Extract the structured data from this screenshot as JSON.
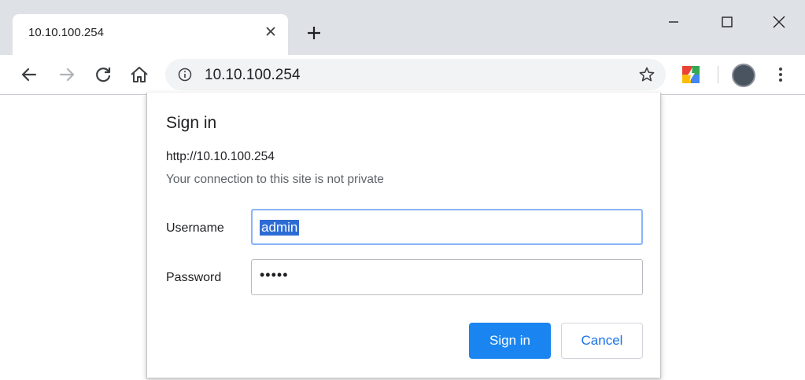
{
  "browser": {
    "tab": {
      "title": "10.10.100.254",
      "close_icon": "close-icon"
    },
    "new_tab_icon": "plus-icon",
    "window_controls": [
      "minimize-icon",
      "maximize-icon",
      "close-icon"
    ],
    "toolbar": {
      "back_icon": "arrow-left-icon",
      "forward_icon": "arrow-right-icon",
      "reload_icon": "reload-icon",
      "home_icon": "home-icon",
      "address": "10.10.100.254",
      "info_icon": "info-icon",
      "bookmark_icon": "star-icon",
      "extension_icon": "extension-icon",
      "profile_icon": "avatar",
      "menu_icon": "kebab-menu-icon"
    }
  },
  "dialog": {
    "title": "Sign in",
    "origin": "http://10.10.100.254",
    "warning": "Your connection to this site is not private",
    "username_label": "Username",
    "username_value": "admin",
    "password_label": "Password",
    "password_value": "•••••",
    "signin_label": "Sign in",
    "cancel_label": "Cancel"
  },
  "colors": {
    "tabstrip": "#dee1e6",
    "accent": "#1a85f0",
    "selection": "#2d6cd4"
  }
}
